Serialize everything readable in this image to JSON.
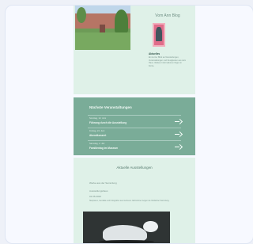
{
  "website": {
    "blog": {
      "title": "Vom Ann Blog",
      "heading": "Aktuelles",
      "text": "Ein kurzer Blick auf Ausstellungen, Veranstaltungen und Neuigkeiten aus dem Haus. Weitere Informationen folgen in Kürze."
    },
    "events": {
      "title": "Nächste Veranstaltungen",
      "items": [
        {
          "date": "Sonntag, 12. Juni",
          "name": "Führung durch die Ausstellung"
        },
        {
          "date": "Freitag, 24. Juni",
          "name": "Abendkonzert"
        },
        {
          "date": "Samstag, 2. Juli",
          "name": "Familientag im Museum"
        }
      ]
    },
    "current": {
      "title": "Aktuelle Ausstellungen",
      "subtitle": "Werke aus der Sammlung",
      "location": "Ausstellungshaus",
      "dates": "01.06.2022",
      "description": "Skulpturen, Gemälde und Fotografien aus mehreren Jahrzehnten zeigen die Vielfalt der Sammlung."
    }
  }
}
